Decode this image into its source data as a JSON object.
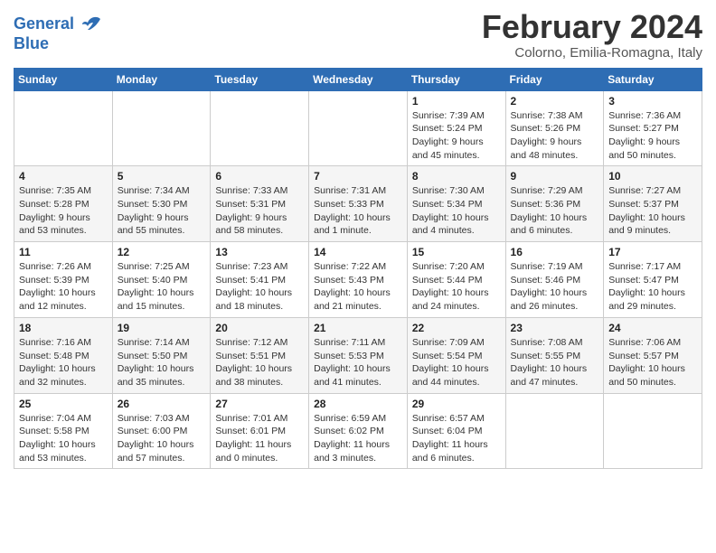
{
  "logo": {
    "line1": "General",
    "line2": "Blue"
  },
  "title": "February 2024",
  "subtitle": "Colorno, Emilia-Romagna, Italy",
  "days_of_week": [
    "Sunday",
    "Monday",
    "Tuesday",
    "Wednesday",
    "Thursday",
    "Friday",
    "Saturday"
  ],
  "weeks": [
    [
      {
        "day": "",
        "info": ""
      },
      {
        "day": "",
        "info": ""
      },
      {
        "day": "",
        "info": ""
      },
      {
        "day": "",
        "info": ""
      },
      {
        "day": "1",
        "info": "Sunrise: 7:39 AM\nSunset: 5:24 PM\nDaylight: 9 hours\nand 45 minutes."
      },
      {
        "day": "2",
        "info": "Sunrise: 7:38 AM\nSunset: 5:26 PM\nDaylight: 9 hours\nand 48 minutes."
      },
      {
        "day": "3",
        "info": "Sunrise: 7:36 AM\nSunset: 5:27 PM\nDaylight: 9 hours\nand 50 minutes."
      }
    ],
    [
      {
        "day": "4",
        "info": "Sunrise: 7:35 AM\nSunset: 5:28 PM\nDaylight: 9 hours\nand 53 minutes."
      },
      {
        "day": "5",
        "info": "Sunrise: 7:34 AM\nSunset: 5:30 PM\nDaylight: 9 hours\nand 55 minutes."
      },
      {
        "day": "6",
        "info": "Sunrise: 7:33 AM\nSunset: 5:31 PM\nDaylight: 9 hours\nand 58 minutes."
      },
      {
        "day": "7",
        "info": "Sunrise: 7:31 AM\nSunset: 5:33 PM\nDaylight: 10 hours\nand 1 minute."
      },
      {
        "day": "8",
        "info": "Sunrise: 7:30 AM\nSunset: 5:34 PM\nDaylight: 10 hours\nand 4 minutes."
      },
      {
        "day": "9",
        "info": "Sunrise: 7:29 AM\nSunset: 5:36 PM\nDaylight: 10 hours\nand 6 minutes."
      },
      {
        "day": "10",
        "info": "Sunrise: 7:27 AM\nSunset: 5:37 PM\nDaylight: 10 hours\nand 9 minutes."
      }
    ],
    [
      {
        "day": "11",
        "info": "Sunrise: 7:26 AM\nSunset: 5:39 PM\nDaylight: 10 hours\nand 12 minutes."
      },
      {
        "day": "12",
        "info": "Sunrise: 7:25 AM\nSunset: 5:40 PM\nDaylight: 10 hours\nand 15 minutes."
      },
      {
        "day": "13",
        "info": "Sunrise: 7:23 AM\nSunset: 5:41 PM\nDaylight: 10 hours\nand 18 minutes."
      },
      {
        "day": "14",
        "info": "Sunrise: 7:22 AM\nSunset: 5:43 PM\nDaylight: 10 hours\nand 21 minutes."
      },
      {
        "day": "15",
        "info": "Sunrise: 7:20 AM\nSunset: 5:44 PM\nDaylight: 10 hours\nand 24 minutes."
      },
      {
        "day": "16",
        "info": "Sunrise: 7:19 AM\nSunset: 5:46 PM\nDaylight: 10 hours\nand 26 minutes."
      },
      {
        "day": "17",
        "info": "Sunrise: 7:17 AM\nSunset: 5:47 PM\nDaylight: 10 hours\nand 29 minutes."
      }
    ],
    [
      {
        "day": "18",
        "info": "Sunrise: 7:16 AM\nSunset: 5:48 PM\nDaylight: 10 hours\nand 32 minutes."
      },
      {
        "day": "19",
        "info": "Sunrise: 7:14 AM\nSunset: 5:50 PM\nDaylight: 10 hours\nand 35 minutes."
      },
      {
        "day": "20",
        "info": "Sunrise: 7:12 AM\nSunset: 5:51 PM\nDaylight: 10 hours\nand 38 minutes."
      },
      {
        "day": "21",
        "info": "Sunrise: 7:11 AM\nSunset: 5:53 PM\nDaylight: 10 hours\nand 41 minutes."
      },
      {
        "day": "22",
        "info": "Sunrise: 7:09 AM\nSunset: 5:54 PM\nDaylight: 10 hours\nand 44 minutes."
      },
      {
        "day": "23",
        "info": "Sunrise: 7:08 AM\nSunset: 5:55 PM\nDaylight: 10 hours\nand 47 minutes."
      },
      {
        "day": "24",
        "info": "Sunrise: 7:06 AM\nSunset: 5:57 PM\nDaylight: 10 hours\nand 50 minutes."
      }
    ],
    [
      {
        "day": "25",
        "info": "Sunrise: 7:04 AM\nSunset: 5:58 PM\nDaylight: 10 hours\nand 53 minutes."
      },
      {
        "day": "26",
        "info": "Sunrise: 7:03 AM\nSunset: 6:00 PM\nDaylight: 10 hours\nand 57 minutes."
      },
      {
        "day": "27",
        "info": "Sunrise: 7:01 AM\nSunset: 6:01 PM\nDaylight: 11 hours\nand 0 minutes."
      },
      {
        "day": "28",
        "info": "Sunrise: 6:59 AM\nSunset: 6:02 PM\nDaylight: 11 hours\nand 3 minutes."
      },
      {
        "day": "29",
        "info": "Sunrise: 6:57 AM\nSunset: 6:04 PM\nDaylight: 11 hours\nand 6 minutes."
      },
      {
        "day": "",
        "info": ""
      },
      {
        "day": "",
        "info": ""
      }
    ]
  ]
}
